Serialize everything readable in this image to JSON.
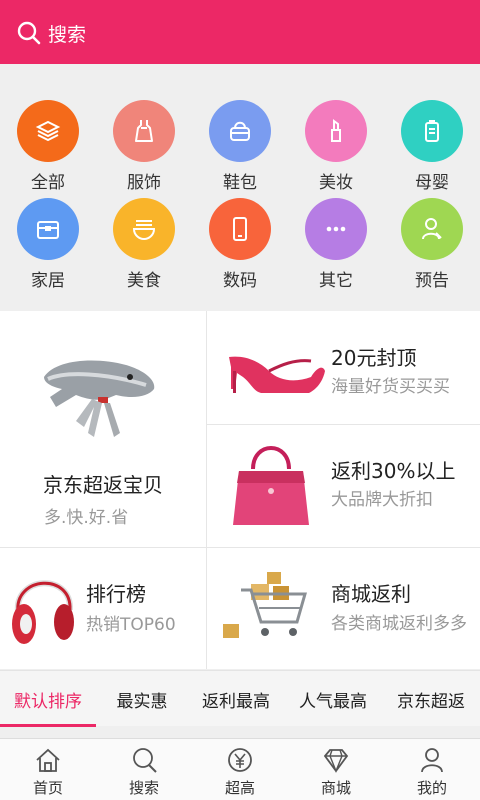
{
  "header": {
    "search_label": "搜索",
    "bg": "#ec2866"
  },
  "categories": [
    {
      "label": "全部",
      "icon": "layers-icon",
      "color": "#f46a1a"
    },
    {
      "label": "服饰",
      "icon": "dress-icon",
      "color": "#f0857a"
    },
    {
      "label": "鞋包",
      "icon": "bag-icon",
      "color": "#7a9cf0"
    },
    {
      "label": "美妆",
      "icon": "lipstick-icon",
      "color": "#f37bbd"
    },
    {
      "label": "母婴",
      "icon": "bottle-icon",
      "color": "#2fd0c2"
    },
    {
      "label": "家居",
      "icon": "home-box-icon",
      "color": "#5e9af2"
    },
    {
      "label": "美食",
      "icon": "bowl-icon",
      "color": "#f9b42a"
    },
    {
      "label": "数码",
      "icon": "phone-icon",
      "color": "#f8643b"
    },
    {
      "label": "其它",
      "icon": "more-icon",
      "color": "#b67de4"
    },
    {
      "label": "预告",
      "icon": "notice-icon",
      "color": "#9fd752"
    }
  ],
  "promos": {
    "jd": {
      "title": "京东超返宝贝",
      "subtitle": "多.快.好.省"
    },
    "cap": {
      "title": "20元封顶",
      "subtitle": "海量好货买买买"
    },
    "rebate": {
      "title": "返利30%以上",
      "subtitle": "大品牌大折扣"
    },
    "rank": {
      "title": "排行榜",
      "subtitle": "热销TOP60"
    },
    "mall": {
      "title": "商城返利",
      "subtitle": "各类商城返利多多"
    }
  },
  "sort_tabs": [
    "默认排序",
    "最实惠",
    "返利最高",
    "人气最高",
    "京东超返"
  ],
  "sort_active": 0,
  "nav": [
    {
      "label": "首页",
      "icon": "home-icon"
    },
    {
      "label": "搜索",
      "icon": "search-icon"
    },
    {
      "label": "超高",
      "icon": "yen-icon"
    },
    {
      "label": "商城",
      "icon": "diamond-icon"
    },
    {
      "label": "我的",
      "icon": "user-icon"
    }
  ],
  "colors": {
    "accent": "#ec2866"
  }
}
